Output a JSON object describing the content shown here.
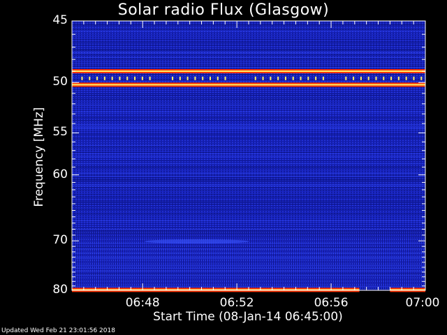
{
  "chart_data": {
    "type": "heatmap",
    "title": "Solar radio Flux (Glasgow)",
    "ylabel": "Frequency [MHz]",
    "xlabel": "Start Time (08-Jan-14 06:45:00)",
    "y_ticks": [
      "45",
      "50",
      "55",
      "60",
      "70",
      "80"
    ],
    "y_tick_values": [
      45,
      50,
      55,
      60,
      70,
      80
    ],
    "y_scale": "reciprocal",
    "ylim": [
      45,
      80
    ],
    "x_ticks": [
      "06:48",
      "06:52",
      "06:56",
      "07:00"
    ],
    "xlim_minutes": [
      0,
      15
    ],
    "x_tick_minutes": [
      3,
      7,
      11,
      15
    ],
    "intense_bands_mhz": [
      49,
      50.2,
      79.9
    ],
    "band_gap_minutes": [
      12.2,
      13.5
    ],
    "colors": {
      "background": "#000000",
      "low": "#0a0a8c",
      "mid": "#2233dd",
      "high": "#ff3300",
      "peak": "#ffee66"
    }
  },
  "footer": "Updated Wed Feb 21 23:01:56 2018"
}
